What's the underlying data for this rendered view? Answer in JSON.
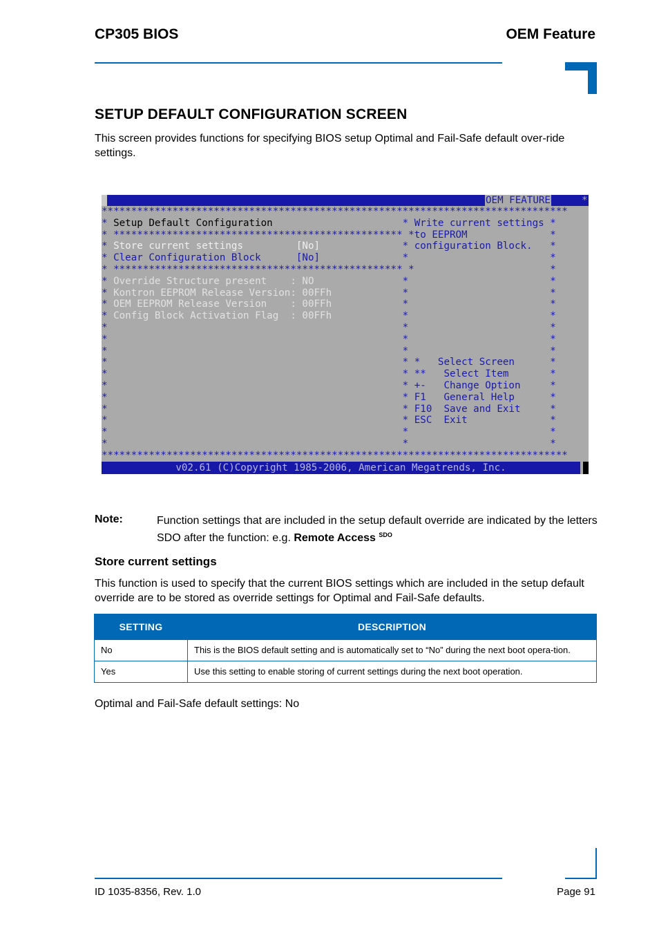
{
  "header": {
    "left_title": "CP305 BIOS",
    "right_title": "OEM Feature",
    "accent_color": "#0068b4"
  },
  "section": {
    "title": "SETUP DEFAULT CONFIGURATION SCREEN",
    "intro": "This screen provides functions for specifying BIOS setup Optimal and Fail-Safe default over-ride settings."
  },
  "bios_screen": {
    "tab_label": "OEM FEATURE",
    "star_row_full": "*******************************************************************************",
    "star_divider_left": "* ************************************************* *",
    "left_title": "Setup Default Configuration",
    "items": [
      {
        "label": "Store current settings",
        "value": "[No]",
        "selected": true
      },
      {
        "label": "Clear Configuration Block",
        "value": "[No]",
        "selected": false
      }
    ],
    "info_rows": [
      {
        "label": "Override Structure present    ",
        "value": ": NO"
      },
      {
        "label": "Kontron EEPROM Release Version",
        "value": ": 00FFh"
      },
      {
        "label": "OEM EEPROM Release Version    ",
        "value": ": 00FFh"
      },
      {
        "label": "Config Block Activation Flag  ",
        "value": ": 00FFh"
      }
    ],
    "help_text": [
      "Write current settings",
      "to EEPROM",
      "configuration Block."
    ],
    "key_help": [
      {
        "key": "*  ",
        "action": " Select Screen"
      },
      {
        "key": "** ",
        "action": "  Select Item"
      },
      {
        "key": "+- ",
        "action": "  Change Option"
      },
      {
        "key": "F1 ",
        "action": "  General Help"
      },
      {
        "key": "F10",
        "action": "  Save and Exit"
      },
      {
        "key": "ESC",
        "action": "  Exit"
      }
    ],
    "footer": "v02.61 (C)Copyright 1985-2006, American Megatrends, Inc.",
    "colors": {
      "background": "#aaaaaa",
      "blue": "#1818a8",
      "text_blue": "#1a1aa8"
    }
  },
  "note": {
    "label": "Note:",
    "text": "Function settings that are included in the setup default override are indicated by the letters SDO after the function: e.g. ",
    "example_bold": "Remote Access",
    "example_sup": "SDO"
  },
  "subsection": {
    "title": "Store current settings",
    "body": "This function is used to specify that the current BIOS settings which are included in the setup default override are to be stored as override settings for Optimal and Fail-Safe defaults."
  },
  "settings_table": {
    "headers": [
      "SETTING",
      "DESCRIPTION"
    ],
    "rows": [
      [
        "No",
        "This is the BIOS default setting and is automatically set to “No” during the next boot opera-tion."
      ],
      [
        "Yes",
        "Use this setting to enable storing of current settings during the next boot operation."
      ]
    ]
  },
  "defaults_line": "Optimal and Fail-Safe default settings: No",
  "footer": {
    "doc_id": "ID 1035-8356, Rev. 1.0",
    "page": "Page 91"
  }
}
